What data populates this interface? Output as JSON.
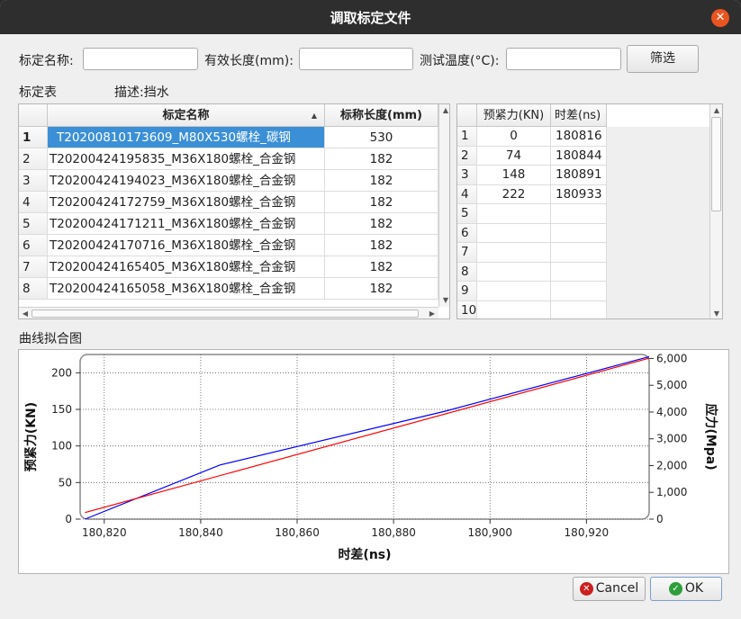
{
  "window": {
    "title": "调取标定文件"
  },
  "filters": {
    "name_label": "标定名称:",
    "length_label": "有效长度(mm):",
    "temp_label": "测试温度(°C):",
    "name_value": "",
    "length_value": "",
    "temp_value": "",
    "filter_button": "筛选"
  },
  "calib_table": {
    "section_label": "标定表",
    "description": "描述:挡水",
    "headers": {
      "name": "标定名称",
      "length": "标称长度(mm)"
    },
    "rows": [
      {
        "index": "1",
        "name": "T20200810173609_M80X530螺栓_碳钢",
        "length": "530"
      },
      {
        "index": "2",
        "name": "T20200424195835_M36X180螺栓_合金钢",
        "length": "182"
      },
      {
        "index": "3",
        "name": "T20200424194023_M36X180螺栓_合金钢",
        "length": "182"
      },
      {
        "index": "4",
        "name": "T20200424172759_M36X180螺栓_合金钢",
        "length": "182"
      },
      {
        "index": "5",
        "name": "T20200424171211_M36X180螺栓_合金钢",
        "length": "182"
      },
      {
        "index": "6",
        "name": "T20200424170716_M36X180螺栓_合金钢",
        "length": "182"
      },
      {
        "index": "7",
        "name": "T20200424165405_M36X180螺栓_合金钢",
        "length": "182"
      },
      {
        "index": "8",
        "name": "T20200424165058_M36X180螺栓_合金钢",
        "length": "182"
      }
    ]
  },
  "data_table": {
    "headers": {
      "force": "预紧力(KN)",
      "time": "时差(ns)"
    },
    "rows": [
      {
        "index": "1",
        "force": "0",
        "time": "180816"
      },
      {
        "index": "2",
        "force": "74",
        "time": "180844"
      },
      {
        "index": "3",
        "force": "148",
        "time": "180891"
      },
      {
        "index": "4",
        "force": "222",
        "time": "180933"
      },
      {
        "index": "5",
        "force": "",
        "time": ""
      },
      {
        "index": "6",
        "force": "",
        "time": ""
      },
      {
        "index": "7",
        "force": "",
        "time": ""
      },
      {
        "index": "8",
        "force": "",
        "time": ""
      },
      {
        "index": "9",
        "force": "",
        "time": ""
      },
      {
        "index": "10",
        "force": "",
        "time": ""
      }
    ]
  },
  "chart_section_label": "曲线拟合图",
  "chart_data": {
    "type": "line",
    "xlabel": "时差(ns)",
    "ylabel": "预紧力(KN)",
    "y2label": "应力(Mpa)",
    "xlim": [
      180815,
      180933
    ],
    "ylim": [
      0,
      225
    ],
    "y2lim": [
      0,
      6150
    ],
    "x_ticks": [
      "180,820",
      "180,840",
      "180,860",
      "180,880",
      "180,900",
      "180,920"
    ],
    "x_tick_values": [
      180820,
      180840,
      180860,
      180880,
      180900,
      180920
    ],
    "y_ticks": [
      "0",
      "50",
      "100",
      "150",
      "200"
    ],
    "y_tick_values": [
      0,
      50,
      100,
      150,
      200
    ],
    "y2_ticks": [
      "0",
      "1,000",
      "2,000",
      "3,000",
      "4,000",
      "5,000",
      "6,000"
    ],
    "y2_tick_values": [
      0,
      1000,
      2000,
      3000,
      4000,
      5000,
      6000
    ],
    "grid": true,
    "series": [
      {
        "color": "#0000ff",
        "x": [
          180816,
          180844,
          180891,
          180933
        ],
        "y": [
          0,
          74,
          148,
          222
        ]
      },
      {
        "color": "#ff0000",
        "x": [
          180816,
          180933
        ],
        "y": [
          9,
          220
        ]
      }
    ]
  },
  "buttons": {
    "cancel": "Cancel",
    "ok": "OK"
  },
  "colors": {
    "accent": "#e95420",
    "selection": "#3b8fd6",
    "titlebar": "#2e2e2e"
  }
}
